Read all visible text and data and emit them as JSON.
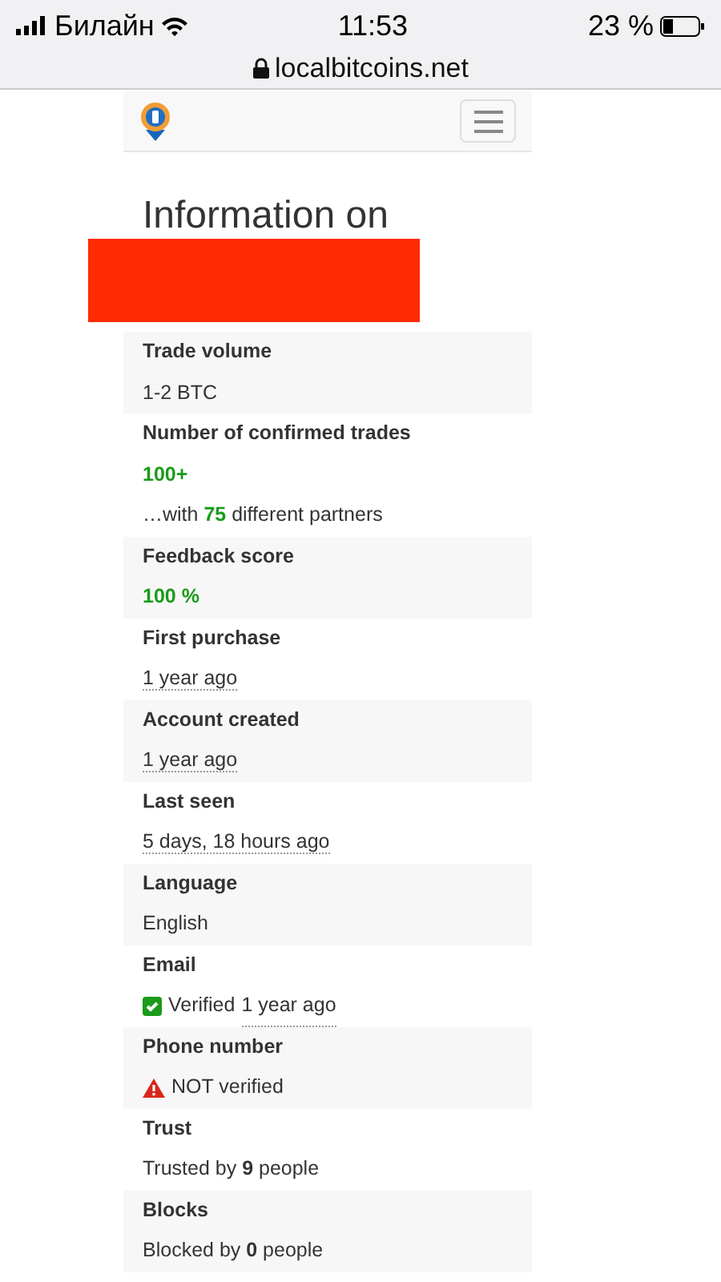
{
  "status_bar": {
    "carrier": "Билайн",
    "time": "11:53",
    "battery": "23 %",
    "url": "localbitcoins.net"
  },
  "heading": "Information on",
  "rows": [
    {
      "label": "Trade volume",
      "values": [
        {
          "kind": "plain",
          "text": "1-2 BTC"
        }
      ]
    },
    {
      "label": "Number of confirmed trades",
      "values": [
        {
          "kind": "good",
          "text": "100+"
        },
        {
          "kind": "partners",
          "text": "…with **75** different partners"
        }
      ]
    },
    {
      "label": "Feedback score",
      "values": [
        {
          "kind": "good",
          "text": "100 %"
        }
      ]
    },
    {
      "label": "First purchase",
      "values": [
        {
          "kind": "time",
          "text": "1 year ago"
        }
      ]
    },
    {
      "label": "Account created",
      "values": [
        {
          "kind": "time",
          "text": "1 year ago"
        }
      ]
    },
    {
      "label": "Last seen",
      "values": [
        {
          "kind": "time",
          "text": "5 days, 18 hours ago"
        }
      ]
    },
    {
      "label": "Language",
      "values": [
        {
          "kind": "plain",
          "text": "English"
        }
      ]
    },
    {
      "label": "Email",
      "values": [
        {
          "kind": "verified",
          "text": "Verified",
          "time": "1 year ago"
        }
      ]
    },
    {
      "label": "Phone number",
      "values": [
        {
          "kind": "not_verified",
          "text": "NOT verified"
        }
      ]
    },
    {
      "label": "Trust",
      "values": [
        {
          "kind": "plain",
          "text": "Trusted by **9** people"
        }
      ]
    },
    {
      "label": "Blocks",
      "values": [
        {
          "kind": "plain",
          "text": "Blocked by **0** people"
        }
      ]
    }
  ]
}
